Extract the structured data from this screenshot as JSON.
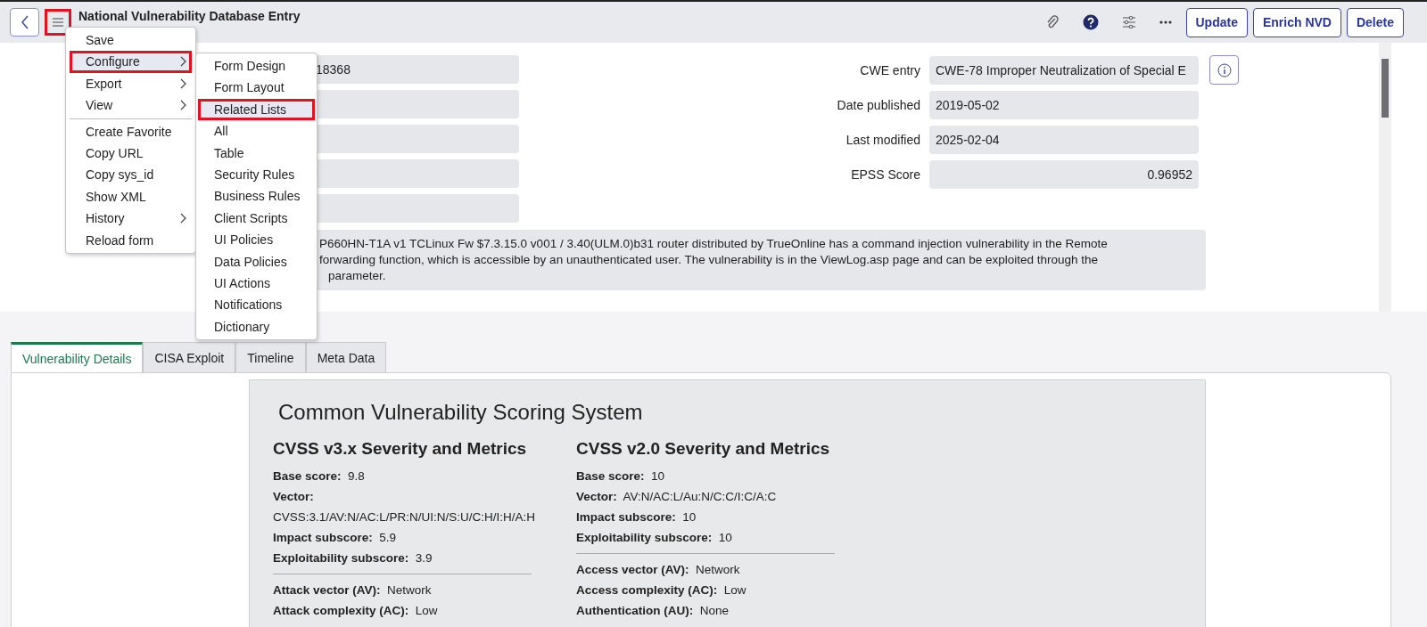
{
  "header": {
    "title": "National Vulnerability Database Entry",
    "menu_button": {
      "annotated": true
    },
    "buttons": [
      "Update",
      "Enrich NVD",
      "Delete"
    ]
  },
  "form": {
    "left_fields": [
      {
        "kind": "filled",
        "value": "18368"
      },
      {
        "kind": "blank"
      },
      {
        "kind": "blank"
      },
      {
        "kind": "blank"
      },
      {
        "kind": "blank"
      }
    ],
    "right_fields": [
      {
        "label": "CWE entry",
        "value": "CWE-78 Improper Neutralization of Special E",
        "kind": "text"
      },
      {
        "label": "Date published",
        "value": "2019-05-02",
        "kind": "text"
      },
      {
        "label": "Last modified",
        "value": "2025-02-04",
        "kind": "text"
      },
      {
        "label": "EPSS Score",
        "value": "0.96952",
        "kind": "number"
      }
    ],
    "description_lines": [
      "P660HN-T1A v1 TCLinux Fw $7.3.15.0 v001 / 3.40(ULM.0)b31 router distributed by TrueOnline has a command injection vulnerability in the Remote",
      "forwarding function, which is accessible by an unauthenticated user. The vulnerability is in the ViewLog.asp page and can be exploited through the",
      "parameter."
    ]
  },
  "context_menu": {
    "items": [
      {
        "kind": "item",
        "label": "Save",
        "submenu": false,
        "highlighted": false,
        "annotated": false
      },
      {
        "kind": "item",
        "label": "Configure",
        "submenu": true,
        "highlighted": true,
        "annotated": true
      },
      {
        "kind": "item",
        "label": "Export",
        "submenu": true,
        "highlighted": false,
        "annotated": false
      },
      {
        "kind": "item",
        "label": "View",
        "submenu": true,
        "highlighted": false,
        "annotated": false
      },
      {
        "kind": "separator"
      },
      {
        "kind": "item",
        "label": "Create Favorite",
        "submenu": false,
        "highlighted": false,
        "annotated": false
      },
      {
        "kind": "item",
        "label": "Copy URL",
        "submenu": false,
        "highlighted": false,
        "annotated": false
      },
      {
        "kind": "item",
        "label": "Copy sys_id",
        "submenu": false,
        "highlighted": false,
        "annotated": false
      },
      {
        "kind": "item",
        "label": "Show XML",
        "submenu": false,
        "highlighted": false,
        "annotated": false
      },
      {
        "kind": "item",
        "label": "History",
        "submenu": true,
        "highlighted": false,
        "annotated": false
      },
      {
        "kind": "item",
        "label": "Reload form",
        "submenu": false,
        "highlighted": false,
        "annotated": false
      }
    ]
  },
  "submenu": {
    "items": [
      {
        "label": "Form Design",
        "highlighted": false,
        "annotated": false
      },
      {
        "label": "Form Layout",
        "highlighted": false,
        "annotated": false
      },
      {
        "label": "Related Lists",
        "highlighted": true,
        "annotated": true
      },
      {
        "label": "All",
        "highlighted": false,
        "annotated": false
      },
      {
        "label": "Table",
        "highlighted": false,
        "annotated": false
      },
      {
        "label": "Security Rules",
        "highlighted": false,
        "annotated": false
      },
      {
        "label": "Business Rules",
        "highlighted": false,
        "annotated": false
      },
      {
        "label": "Client Scripts",
        "highlighted": false,
        "annotated": false
      },
      {
        "label": "UI Policies",
        "highlighted": false,
        "annotated": false
      },
      {
        "label": "Data Policies",
        "highlighted": false,
        "annotated": false
      },
      {
        "label": "UI Actions",
        "highlighted": false,
        "annotated": false
      },
      {
        "label": "Notifications",
        "highlighted": false,
        "annotated": false
      },
      {
        "label": "Dictionary",
        "highlighted": false,
        "annotated": false
      }
    ]
  },
  "tabs": [
    {
      "label": "Vulnerability Details",
      "selected": true
    },
    {
      "label": "CISA Exploit",
      "selected": false
    },
    {
      "label": "Timeline",
      "selected": false
    },
    {
      "label": "Meta Data",
      "selected": false
    }
  ],
  "cvss": {
    "title": "Common Vulnerability Scoring System",
    "sections": [
      {
        "heading": "CVSS v3.x Severity and Metrics",
        "scores": [
          {
            "label": "Base score:",
            "value": "9.8",
            "kind": "inline"
          },
          {
            "label": "Vector:",
            "value": "CVSS:3.1/AV:N/AC:L/PR:N/UI:N/S:U/C:H/I:H/A:H",
            "kind": "stacked"
          },
          {
            "label": "Impact subscore:",
            "value": "5.9",
            "kind": "inline"
          },
          {
            "label": "Exploitability subscore:",
            "value": "3.9",
            "kind": "inline"
          }
        ],
        "metrics": [
          {
            "label": "Attack vector (AV):",
            "value": "Network"
          },
          {
            "label": "Attack complexity (AC):",
            "value": "Low"
          }
        ]
      },
      {
        "heading": "CVSS v2.0 Severity and Metrics",
        "scores": [
          {
            "label": "Base score:",
            "value": "10",
            "kind": "inline"
          },
          {
            "label": "Vector:",
            "value": "AV:N/AC:L/Au:N/C:C/I:C/A:C",
            "kind": "inline"
          },
          {
            "label": "Impact subscore:",
            "value": "10",
            "kind": "inline"
          },
          {
            "label": "Exploitability subscore:",
            "value": "10",
            "kind": "inline"
          }
        ],
        "metrics": [
          {
            "label": "Access vector (AV):",
            "value": "Network"
          },
          {
            "label": "Access complexity (AC):",
            "value": "Low"
          },
          {
            "label": "Authentication (AU):",
            "value": "None"
          }
        ]
      }
    ]
  }
}
